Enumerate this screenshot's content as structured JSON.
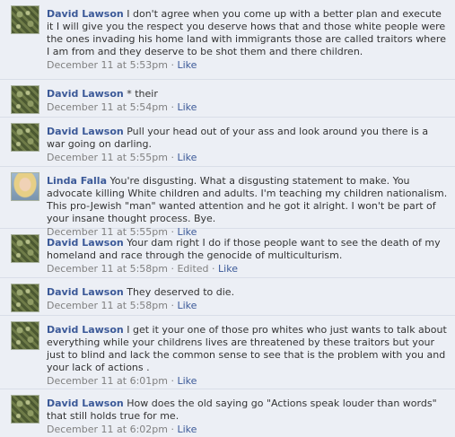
{
  "comments": [
    {
      "author": "David Lawson",
      "avatar": "camo-pattern",
      "text": "I don't agree when you come up with a better plan and execute it I will give you the respect you deserve hows that and those white people were the ones invading his home land with immigrants those are called traitors where I am from and they deserve to be shot them and there children.",
      "timestamp": "December 11 at 5:53pm",
      "edited": "",
      "like_label": "Like"
    },
    {
      "author": "David Lawson",
      "avatar": "camo-pattern",
      "text": "* their",
      "timestamp": "December 11 at 5:54pm",
      "edited": "",
      "like_label": "Like"
    },
    {
      "author": "David Lawson",
      "avatar": "camo-pattern",
      "text": "Pull your head out of your ass and look around you there is a war going on darling.",
      "timestamp": "December 11 at 5:55pm",
      "edited": "",
      "like_label": "Like"
    },
    {
      "author": "Linda Falla",
      "avatar": "profile-photo",
      "text": "You're disgusting. What a disgusting statement to make. You advocate killing White children and adults. I'm teaching my children nationalism. This pro-Jewish \"man\" wanted attention and he got it alright. I won't be part of your insane thought process. Bye.",
      "timestamp": "December 11 at 5:55pm",
      "edited": "",
      "like_label": "Like"
    },
    {
      "author": "David Lawson",
      "avatar": "camo-pattern",
      "text": "Your dam right I do if those people want to see the death of my homeland and race through the genocide of multiculturism.",
      "timestamp": "December 11 at 5:58pm",
      "edited": "Edited",
      "like_label": "Like"
    },
    {
      "author": "David Lawson",
      "avatar": "camo-pattern",
      "text": "They deserved to die.",
      "timestamp": "December 11 at 5:58pm",
      "edited": "",
      "like_label": "Like"
    },
    {
      "author": "David Lawson",
      "avatar": "camo-pattern",
      "text": "I get it your one of those pro whites who just wants to talk about everything while your childrens lives are threatened by these traitors but your just to blind and lack the common sense to see that is the problem with you and your lack of actions .",
      "timestamp": "December 11 at 6:01pm",
      "edited": "",
      "like_label": "Like"
    },
    {
      "author": "David Lawson",
      "avatar": "camo-pattern",
      "text": "How does the old saying go \"Actions speak louder than words\" that still holds true for me.",
      "timestamp": "December 11 at 6:02pm",
      "edited": "",
      "like_label": "Like"
    }
  ]
}
